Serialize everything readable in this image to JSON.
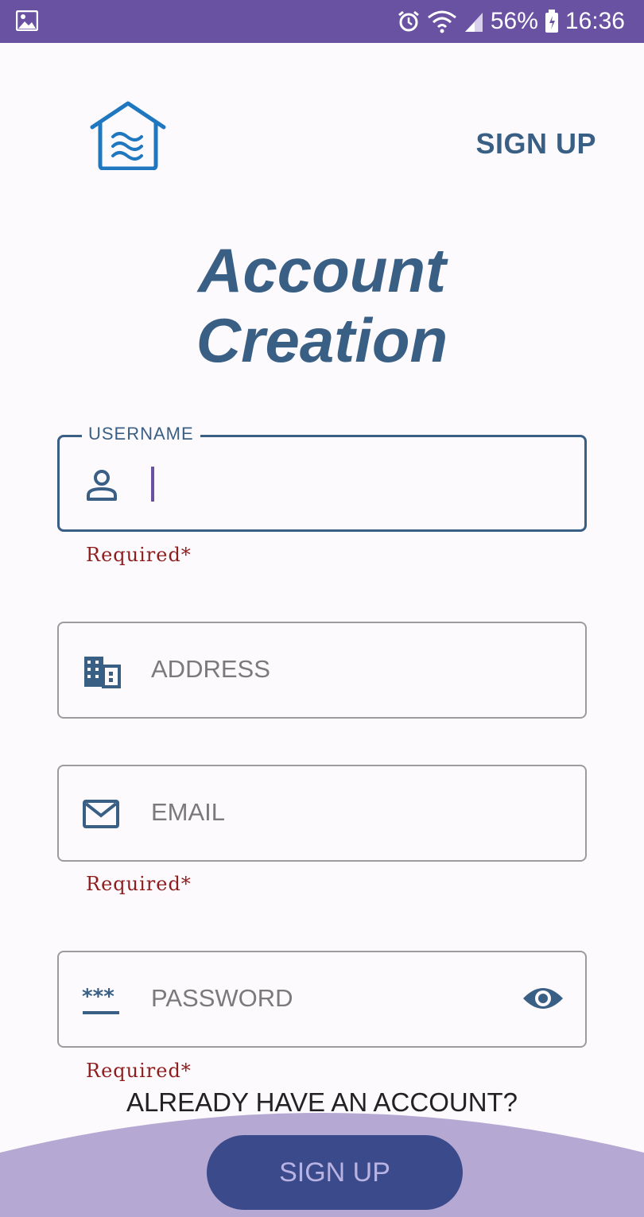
{
  "status_bar": {
    "battery": "56%",
    "time": "16:36",
    "icons": [
      "gallery-icon",
      "alarm-icon",
      "wifi-icon",
      "signal-icon",
      "battery-icon"
    ]
  },
  "header": {
    "logo": "house-logo-icon",
    "signup_link": "SIGN UP"
  },
  "title": {
    "line1": "Account",
    "line2": "Creation"
  },
  "form": {
    "username": {
      "label": "USERNAME",
      "value": "",
      "required_text": "Required*"
    },
    "address": {
      "placeholder": "ADDRESS"
    },
    "email": {
      "placeholder": "EMAIL",
      "required_text": "Required*"
    },
    "password": {
      "placeholder": "PASSWORD",
      "required_text": "Required*"
    }
  },
  "footer": {
    "already_text": "ALREADY HAVE AN ACCOUNT?",
    "signup_button": "SIGN UP"
  },
  "colors": {
    "status_bar": "#6a52a3",
    "primary": "#3a5f85",
    "error": "#8e1d1d",
    "wave": "#b5a9d3",
    "button": "#3b4a8a",
    "logo": "#1f77c0"
  }
}
